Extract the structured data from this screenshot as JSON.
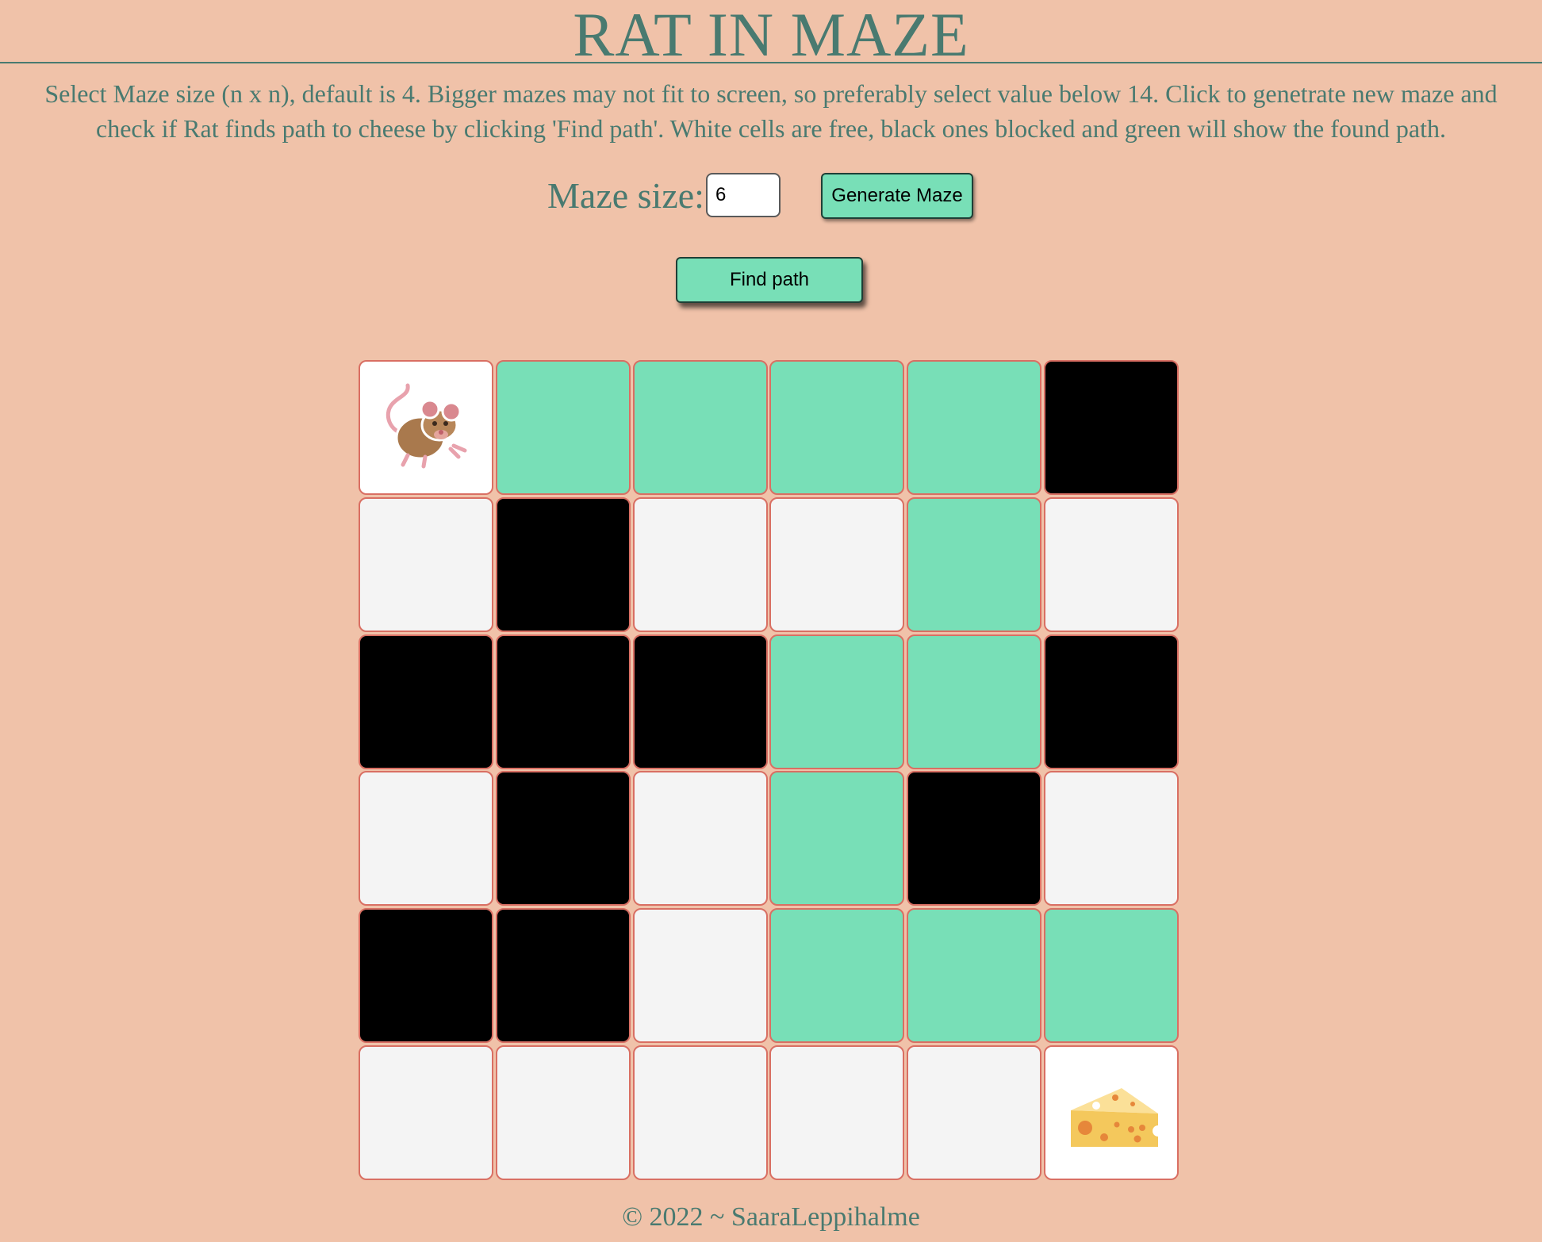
{
  "title": "RAT IN MAZE",
  "intro": "Select Maze size (n x n), default is 4. Bigger mazes may not fit to screen, so preferably select value below 14. Click to genetrate new maze and check if Rat finds path to cheese by clicking 'Find path'. White cells are free, black ones blocked and green will show the found path.",
  "controls": {
    "size_label": "Maze size:",
    "size_value": "6",
    "generate_label": "Generate Maze",
    "find_label": "Find path"
  },
  "maze": {
    "size": 6,
    "legend": {
      "free": "#f4f4f4",
      "blocked": "#000000",
      "path": "#78dfb7"
    },
    "start_icon": "rat-icon",
    "goal_icon": "cheese-icon",
    "grid": [
      [
        "start",
        "path",
        "path",
        "path",
        "path",
        "blocked"
      ],
      [
        "free",
        "blocked",
        "free",
        "free",
        "path",
        "free"
      ],
      [
        "blocked",
        "blocked",
        "blocked",
        "path",
        "path",
        "blocked"
      ],
      [
        "free",
        "blocked",
        "free",
        "path",
        "blocked",
        "free"
      ],
      [
        "blocked",
        "blocked",
        "free",
        "path",
        "path",
        "path"
      ],
      [
        "free",
        "free",
        "free",
        "free",
        "free",
        "goal"
      ]
    ]
  },
  "footer": "© 2022 ~ SaaraLeppihalme",
  "colors": {
    "background": "#f0c2a9",
    "text": "#497a70",
    "accent": "#78dfb7",
    "cell_border": "#d96f63"
  }
}
